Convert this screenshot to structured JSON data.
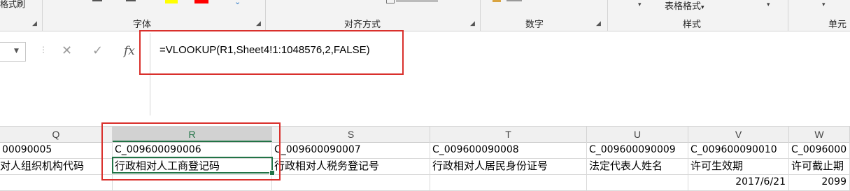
{
  "ribbon": {
    "clipboard_tail": "格式刷",
    "groups": [
      "字体",
      "对齐方式",
      "数字",
      "样式",
      "单元"
    ],
    "table_format": "表格格式",
    "table_format_arrow": "▾"
  },
  "formula_bar": {
    "cancel_glyph": "✕",
    "enter_glyph": "✓",
    "fx_label": "fx",
    "formula": "=VLOOKUP(R1,Sheet4!1:1048576,2,FALSE)"
  },
  "sheet": {
    "columns": [
      "Q",
      "R",
      "S",
      "T",
      "U",
      "V",
      "W"
    ],
    "selected_column": "R",
    "rows": [
      [
        "00090005",
        "C_009600090006",
        "C_009600090007",
        "C_009600090008",
        "C_009600090009",
        "C_009600090010",
        "C_0096000"
      ],
      [
        "对人组织机构代码",
        "行政相对人工商登记码",
        "行政相对人税务登记号",
        "行政相对人居民身份证号",
        "法定代表人姓名",
        "许可生效期",
        "许可截止期"
      ],
      [
        "",
        "",
        "",
        "",
        "",
        "2017/6/21",
        "2099"
      ]
    ]
  }
}
